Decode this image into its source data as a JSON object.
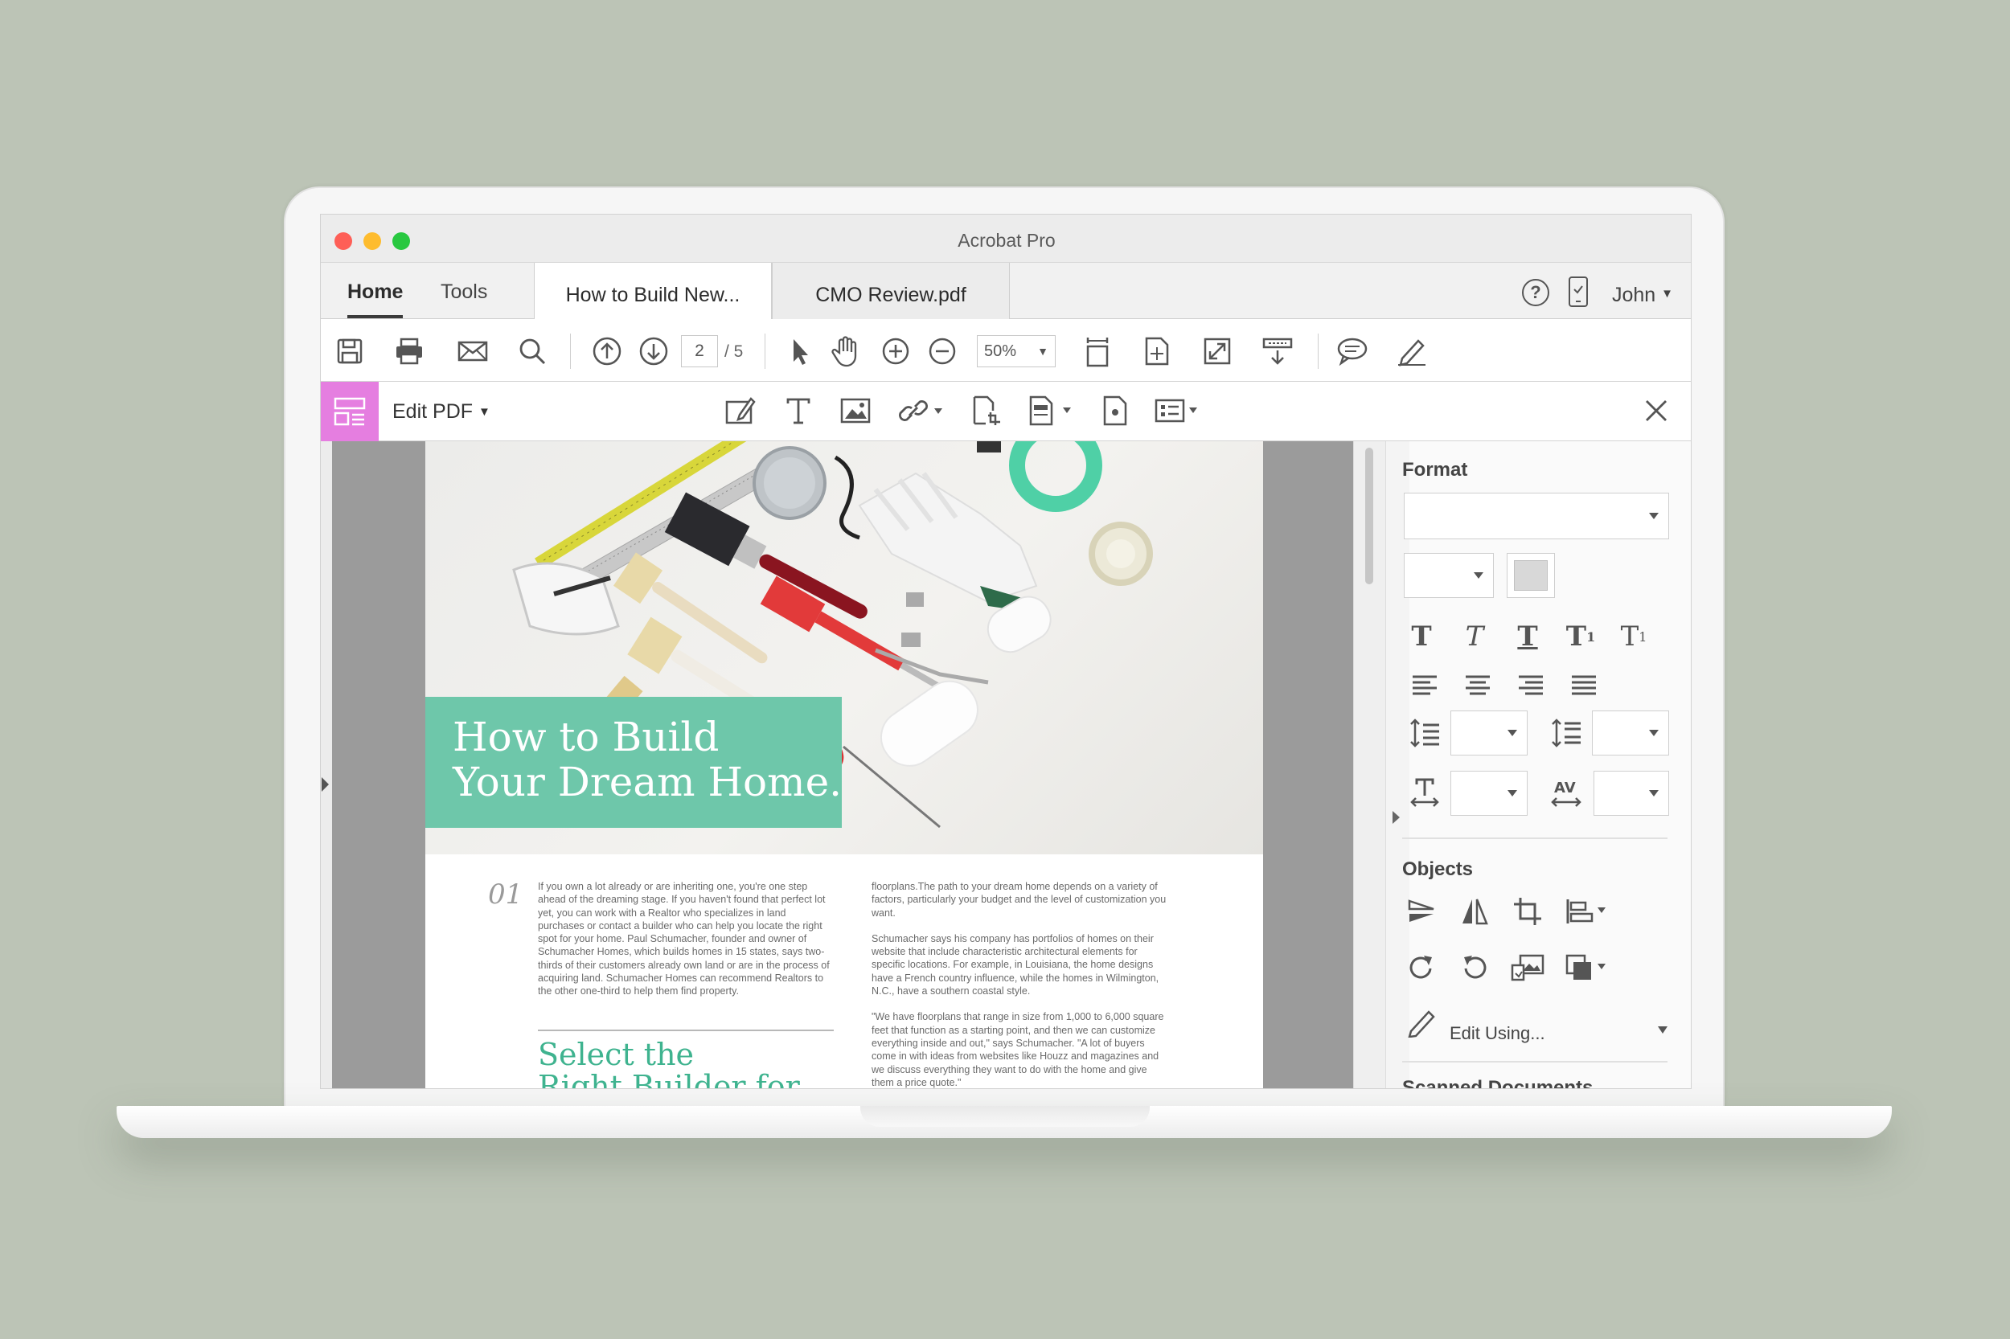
{
  "window": {
    "title": "Acrobat Pro"
  },
  "tabs": {
    "home": "Home",
    "tools": "Tools",
    "documents": [
      {
        "label": "How to Build New...",
        "active": true
      },
      {
        "label": "CMO Review.pdf",
        "active": false
      }
    ],
    "user": "John"
  },
  "toolbar": {
    "current_page": "2",
    "page_total": "/ 5",
    "zoom": "50%"
  },
  "edit_bar": {
    "label": "Edit PDF"
  },
  "document": {
    "hero_title_line1": "How to Build",
    "hero_title_line2": "Your Dream Home.",
    "section_number": "01",
    "column1_text": "If you own a lot already or are inheriting one, you're one step ahead of the dreaming stage. If you haven't found that perfect lot yet, you can work with a Realtor who specializes in land purchases or contact a builder who can help you locate the right spot for your home. Paul Schumacher, founder and owner of Schumacher Homes, which builds homes in 15 states, says two-thirds of their customers already own land or are in the process of acquiring land. Schumacher Homes can recommend Realtors to the other one-third to help them find property.",
    "subheading_line1": "Select the",
    "subheading_line2": "Right Builder for",
    "column2_p1": "floorplans.The path to your dream home depends on a variety of factors, particularly your budget and the level of customization you want.",
    "column2_p2": "Schumacher says his company has portfolios of homes on their website that include characteristic architectural elements for specific locations. For example, in Louisiana, the home designs have a French country influence, while the homes in Wilmington, N.C., have a southern coastal style.",
    "column2_p3": "\"We have floorplans that range in size from 1,000 to 6,000 square feet that function as a starting point, and then we can customize everything inside and out,\" says Schumacher. \"A lot of buyers come in with ideas from websites like Houzz and magazines and we discuss everything they want to do with the home and give them a price quote.\""
  },
  "right_panel": {
    "format_heading": "Format",
    "objects_heading": "Objects",
    "edit_using": "Edit Using...",
    "next_heading_partial": "Scanned Documents"
  },
  "colors": {
    "accent_edit": "#e57ee0",
    "hero_green": "#6ec7aa",
    "subheading_green": "#3fb38f"
  }
}
